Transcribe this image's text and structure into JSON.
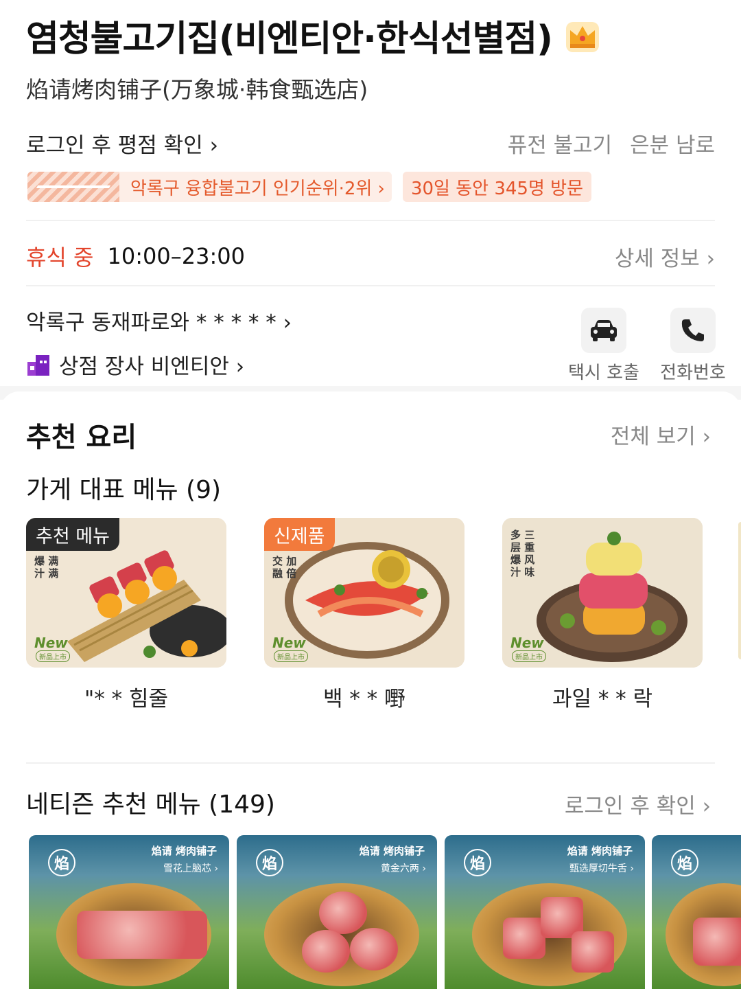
{
  "store": {
    "name": "염청불고기집(비엔티안·한식선별점)",
    "name_cn": "焰请烤肉铺子(万象城·韩食甄选店)",
    "rating_link": "로그인 후 평점 확인 ›",
    "categories": [
      "퓨전 불고기",
      "은분 남로"
    ],
    "rank_badge": "악록구 융합불고기 인기순위·2위 ›",
    "visit_badge": "30일 동안 345명 방문",
    "status": "휴식 중",
    "hours": "10:00–23:00",
    "detail_link": "상세 정보 ›",
    "address": "악록구 동재파로와 * * * * * ›",
    "mall": "상점 장사 비엔티안 ›"
  },
  "actions": [
    {
      "label": "택시 호출",
      "icon": "car-icon"
    },
    {
      "label": "전화번호",
      "icon": "phone-icon"
    }
  ],
  "recommend": {
    "title": "추천 요리",
    "view_all": "전체 보기 ›",
    "signature_title": "가게 대표 메뉴 (9)",
    "dishes": [
      {
        "tag": "추천 메뉴",
        "tag_color": "#2b2b2b",
        "vtext": "爆 满\n汁 满",
        "new": "New",
        "new_sub": "新品上市",
        "name": "\"* * 힘줄"
      },
      {
        "tag": "신제품",
        "tag_color": "#f27a3c",
        "vtext": "交 加\n融 倍",
        "new": "New",
        "new_sub": "新品上市",
        "name": "백 * * 嘢"
      },
      {
        "tag": "",
        "tag_color": "",
        "vtext": "多 三\n层 重\n爆 风\n汁 味",
        "new": "New",
        "new_sub": "新品上市",
        "name": "과일 * * 락"
      }
    ]
  },
  "netizen": {
    "title": "네티즌 추천 메뉴 (149)",
    "login_check": "로그인 후 확인 ›",
    "photos": [
      {
        "brand": "焰请 烤肉铺子",
        "dish": "雪花上脑芯 ›",
        "logo": "焰"
      },
      {
        "brand": "焰请 烤肉铺子",
        "dish": "黄金六两 ›",
        "logo": "焰"
      },
      {
        "brand": "焰请 烤肉铺子",
        "dish": "甄选厚切牛舌 ›",
        "logo": "焰"
      },
      {
        "brand": "",
        "dish": "",
        "logo": "焰"
      }
    ]
  },
  "colors": {
    "accent_red": "#e3452c",
    "badge_bg": "#fde6dc",
    "muted_text": "#888888"
  }
}
